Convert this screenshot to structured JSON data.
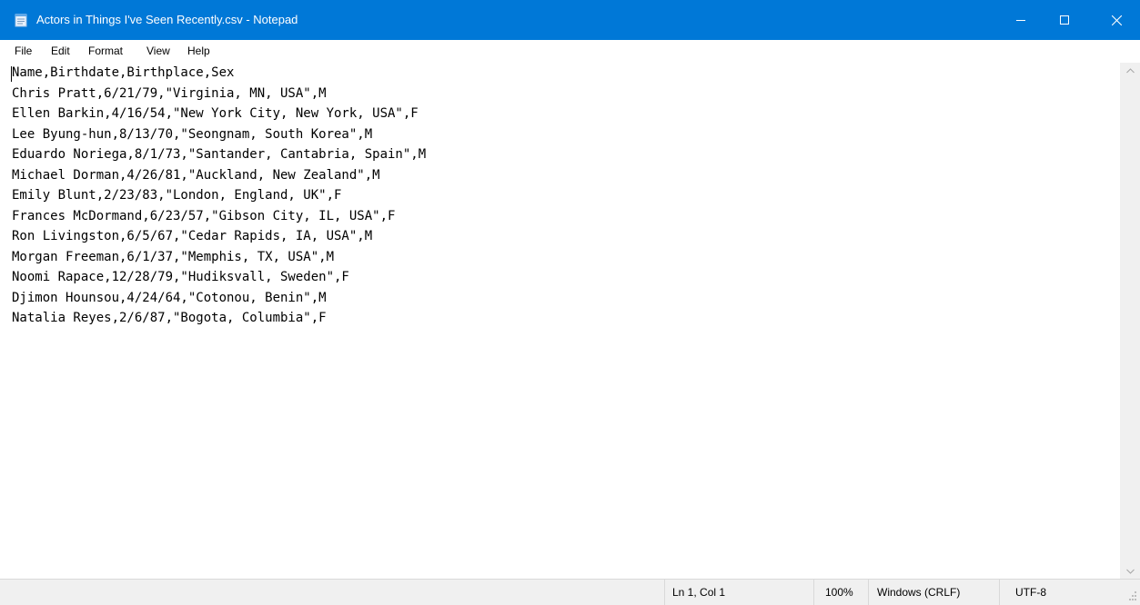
{
  "window": {
    "title": "Actors in Things I've Seen Recently.csv - Notepad",
    "app_icon": "notepad-icon",
    "title_bar_color": "#0078d7",
    "controls": [
      "minimize-icon",
      "maximize-icon",
      "close-icon"
    ]
  },
  "menu": {
    "file": "File",
    "edit": "Edit",
    "format": "Format",
    "view": "View",
    "help": "Help"
  },
  "editor": {
    "text": "Name,Birthdate,Birthplace,Sex\nChris Pratt,6/21/79,\"Virginia, MN, USA\",M\nEllen Barkin,4/16/54,\"New York City, New York, USA\",F\nLee Byung-hun,8/13/70,\"Seongnam, South Korea\",M\nEduardo Noriega,8/1/73,\"Santander, Cantabria, Spain\",M\nMichael Dorman,4/26/81,\"Auckland, New Zealand\",M\nEmily Blunt,2/23/83,\"London, England, UK\",F\nFrances McDormand,6/23/57,\"Gibson City, IL, USA\",F\nRon Livingston,6/5/67,\"Cedar Rapids, IA, USA\",M\nMorgan Freeman,6/1/37,\"Memphis, TX, USA\",M\nNoomi Rapace,12/28/79,\"Hudiksvall, Sweden\",F\nDjimon Hounsou,4/24/64,\"Cotonou, Benin\",M\nNatalia Reyes,2/6/87,\"Bogota, Columbia\",F"
  },
  "status": {
    "position": "Ln 1, Col 1",
    "zoom": "100%",
    "line_endings": "Windows (CRLF)",
    "encoding": "UTF-8"
  }
}
